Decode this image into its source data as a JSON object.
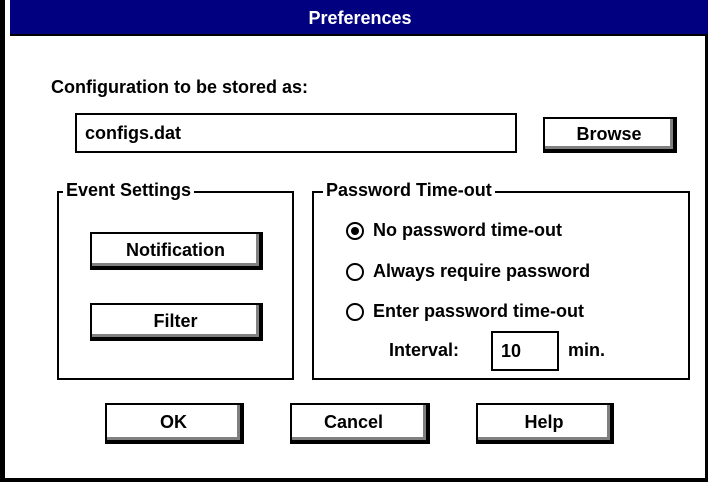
{
  "window": {
    "title": "Preferences"
  },
  "config": {
    "label": "Configuration to be stored as:",
    "file_value": "configs.dat",
    "browse_label": "Browse"
  },
  "event_settings": {
    "legend": "Event Settings",
    "notification_label": "Notification",
    "filter_label": "Filter"
  },
  "password_timeout": {
    "legend": "Password Time-out",
    "options": [
      {
        "label": "No password time-out",
        "selected": true
      },
      {
        "label": "Always require password",
        "selected": false
      },
      {
        "label": "Enter password time-out",
        "selected": false
      }
    ],
    "interval_label": "Interval:",
    "interval_value": "10",
    "unit_label": "min."
  },
  "footer": {
    "ok_label": "OK",
    "cancel_label": "Cancel",
    "help_label": "Help"
  }
}
